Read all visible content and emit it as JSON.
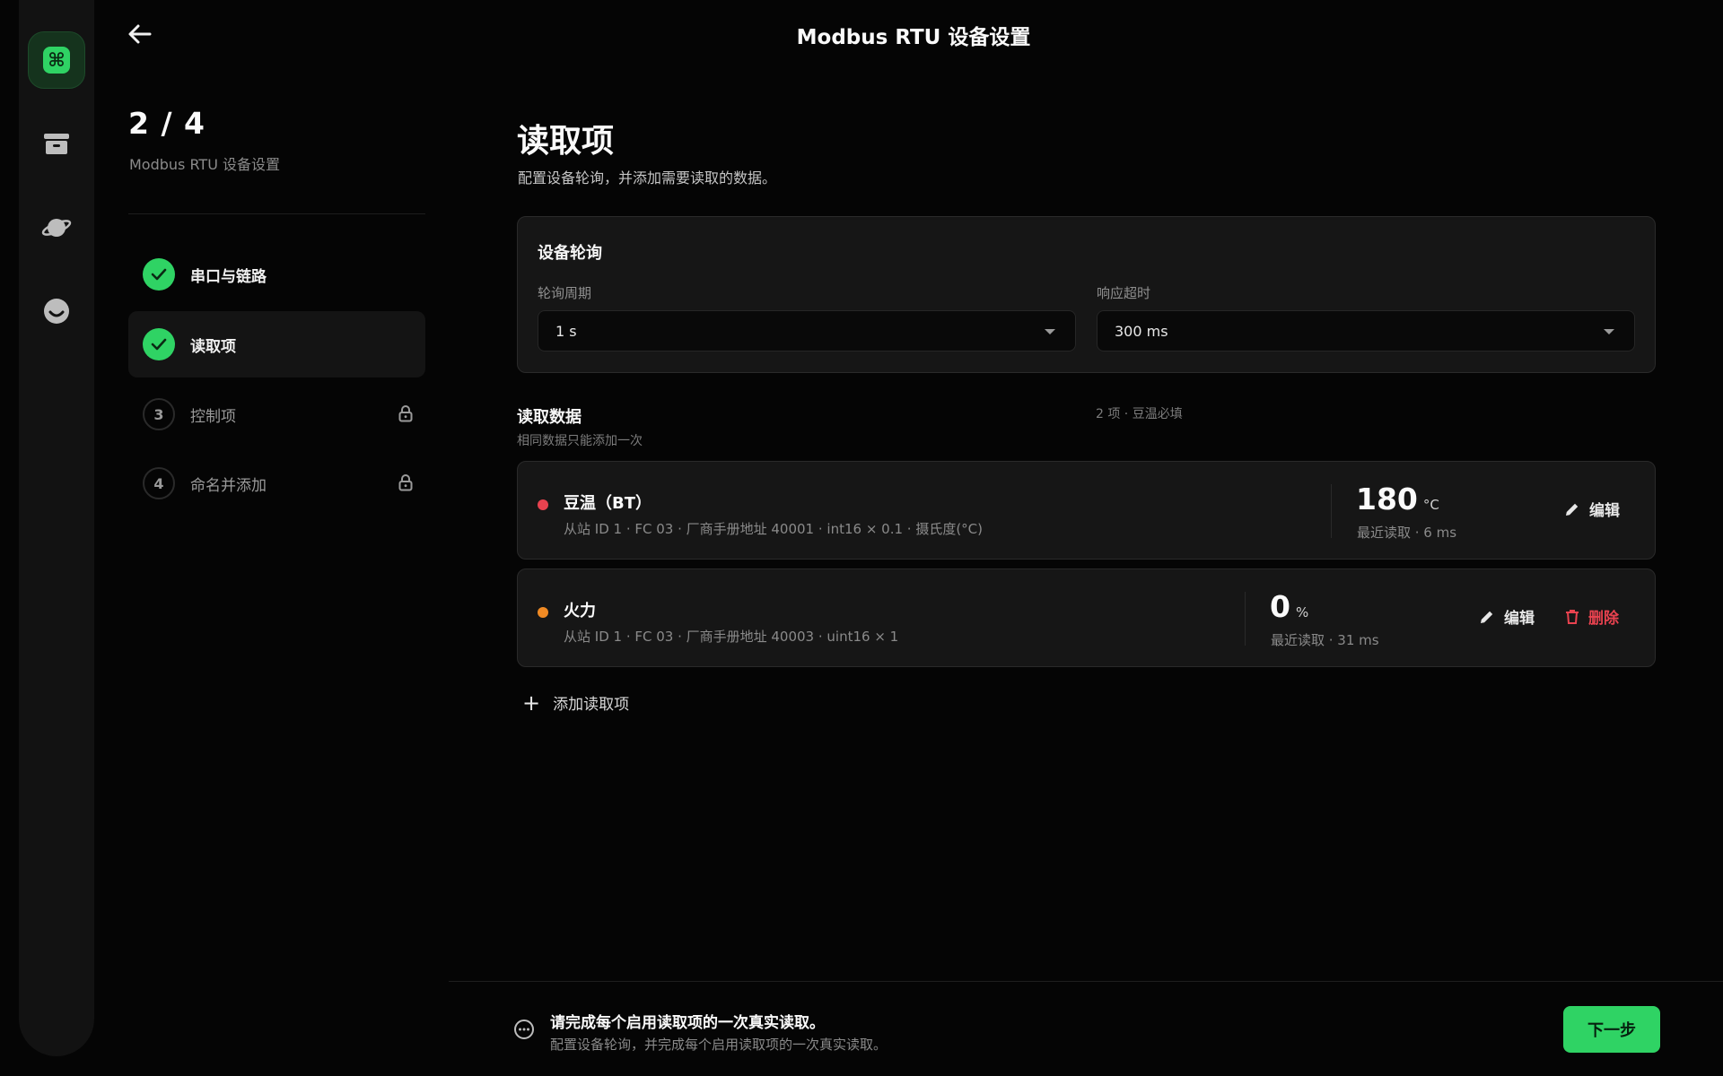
{
  "header": {
    "title": "Modbus RTU 设备设置",
    "back_icon": "arrow-left-icon"
  },
  "rail": {
    "items": [
      {
        "icon": "app-command-icon",
        "glyph": "⌘",
        "active": true
      },
      {
        "icon": "archive-icon",
        "active": false
      },
      {
        "icon": "planet-icon",
        "active": false
      },
      {
        "icon": "smiley-icon",
        "active": false
      }
    ]
  },
  "steps": {
    "progress": "2 / 4",
    "subtitle": "Modbus RTU 设备设置",
    "items": [
      {
        "number": "1",
        "label": "串口与链路",
        "state": "done"
      },
      {
        "number": "2",
        "label": "读取项",
        "state": "current"
      },
      {
        "number": "3",
        "label": "控制项",
        "state": "locked"
      },
      {
        "number": "4",
        "label": "命名并添加",
        "state": "locked"
      }
    ]
  },
  "main": {
    "title": "读取项",
    "description": "配置设备轮询，并添加需要读取的数据。",
    "polling": {
      "title": "设备轮询",
      "period_label": "轮询周期",
      "period_value": "1 s",
      "timeout_label": "响应超时",
      "timeout_value": "300 ms"
    },
    "read_data": {
      "title": "读取数据",
      "note": "相同数据只能添加一次",
      "count": "2 项 · 豆温必填",
      "items": [
        {
          "name": "豆温（BT）",
          "dot_color": "#e8424f",
          "meta": "从站 ID 1  ·  FC 03  ·  厂商手册地址 40001  ·  int16 × 0.1  ·  摄氏度(°C)",
          "value": "180",
          "unit": "°C",
          "last_read": "最近读取 · 6 ms",
          "edit_label": "编辑"
        },
        {
          "name": "火力",
          "dot_color": "#f08a24",
          "meta": "从站 ID 1  ·  FC 03  ·  厂商手册地址 40003  ·  uint16 × 1",
          "value": "0",
          "unit": "%",
          "last_read": "最近读取 · 31 ms",
          "edit_label": "编辑",
          "delete_label": "删除"
        }
      ],
      "add_label": "添加读取项"
    }
  },
  "footer": {
    "title": "请完成每个启用读取项的一次真实读取。",
    "description": "配置设备轮询，并完成每个启用读取项的一次真实读取。",
    "next_label": "下一步"
  },
  "colors": {
    "accent": "#2fd364",
    "danger": "#e8424f",
    "warning": "#f08a24"
  }
}
